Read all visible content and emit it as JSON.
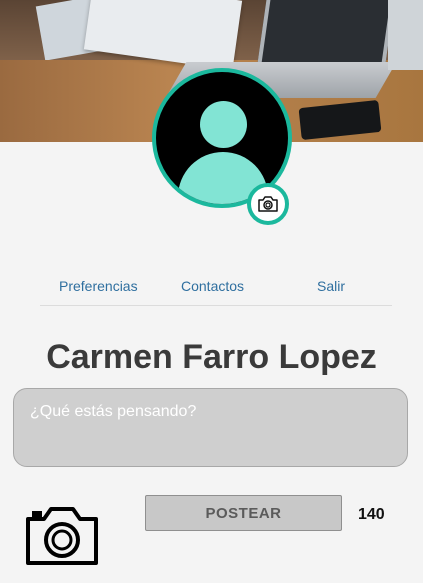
{
  "profile": {
    "name": "Carmen Farro Lopez"
  },
  "nav": {
    "items": [
      {
        "label": "Preferencias"
      },
      {
        "label": "Contactos"
      },
      {
        "label": "Salir"
      }
    ]
  },
  "composer": {
    "placeholder": "¿Qué estás pensando?",
    "value": "",
    "post_label": "POSTEAR",
    "char_count": "140"
  },
  "colors": {
    "accent": "#1bb89d",
    "avatar_fill": "#82e4d4",
    "nav_link": "#2f6f9f"
  },
  "icons": {
    "cover": "cover-photo-desk-laptop",
    "avatar": "user-silhouette-icon",
    "avatar_change": "camera-icon",
    "attach_photo": "camera-icon"
  }
}
